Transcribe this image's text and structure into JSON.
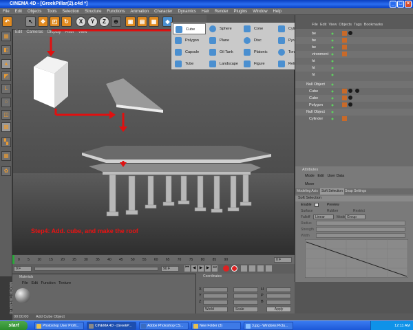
{
  "window": {
    "title": "CINEMA 4D - [GreekPillar(2).c4d *]"
  },
  "menu": [
    "File",
    "Edit",
    "Objects",
    "Tools",
    "Selection",
    "Structure",
    "Functions",
    "Animation",
    "Character",
    "Dynamics",
    "Hair",
    "Render",
    "Plugins",
    "Window",
    "Help"
  ],
  "toolbar": {
    "tools": [
      "undo",
      "redo",
      "move",
      "scale",
      "rotate",
      "x-axis",
      "y-axis",
      "z-axis",
      "world-coords",
      "render-view",
      "render-picture",
      "render-settings",
      "cube"
    ]
  },
  "viewport": {
    "menu": [
      "Edit",
      "Cameras",
      "Display",
      "Filter",
      "View"
    ],
    "step_text": "Step4: Add. cube, and make the roof"
  },
  "primitives_menu": {
    "items": [
      {
        "label": "Cube",
        "selected": true
      },
      {
        "label": "Sphere"
      },
      {
        "label": "Cone"
      },
      {
        "label": "Cylinder"
      },
      {
        "label": "Polygon"
      },
      {
        "label": "Plane"
      },
      {
        "label": "Disc"
      },
      {
        "label": "Pyramid"
      },
      {
        "label": "Capsule"
      },
      {
        "label": "Oil Tank"
      },
      {
        "label": "Platonic"
      },
      {
        "label": "Torus"
      },
      {
        "label": "Tube"
      },
      {
        "label": "Landscape"
      },
      {
        "label": "Figure"
      },
      {
        "label": "Relief"
      }
    ]
  },
  "object_manager": {
    "menu": [
      "File",
      "Edit",
      "View",
      "Objects",
      "Tags",
      "Bookmarks"
    ],
    "rows": [
      "be",
      "be",
      "be",
      "vironment",
      "ht",
      "ht",
      "ht",
      "Null Object",
      "Cube",
      "Cube",
      "Polygon",
      "Null Object",
      "Cylinder"
    ]
  },
  "attributes": {
    "title": "Attributes",
    "menu": [
      "Mode",
      "Edit",
      "User Data"
    ],
    "object": "Move",
    "tabs": [
      "Modeling Axis",
      "Soft Selection",
      "Snap Settings"
    ],
    "section": "Soft Selection",
    "fields": {
      "enable": "Enable",
      "preview": "Preview",
      "surface": "Surface",
      "rubber": "Rubber",
      "restrict": "Restrict",
      "falloff": "Falloff",
      "falloff_value": "Linear",
      "mode": "Mode",
      "mode_value": "Group",
      "radius": "Radius",
      "strength": "Strength",
      "width": "Width"
    }
  },
  "timeline": {
    "ticks": [
      "0",
      "5",
      "10",
      "15",
      "20",
      "25",
      "30",
      "35",
      "40",
      "45",
      "50",
      "55",
      "60",
      "65",
      "70",
      "75",
      "80",
      "85",
      "90"
    ],
    "frame": "0 F"
  },
  "playback": {
    "current_frame": "0 F",
    "end_frame": "90 F"
  },
  "materials": {
    "title": "Materials",
    "menu": [
      "File",
      "Edit",
      "Function",
      "Texture"
    ]
  },
  "coordinates": {
    "title": "Coordinates",
    "axes": [
      "X",
      "Y",
      "Z"
    ],
    "rot_axes": [
      "H",
      "P",
      "B"
    ],
    "mode1": "World",
    "mode2": "Scale",
    "apply": "Apply"
  },
  "status": {
    "text": "Add Cube Object",
    "time": "00:00:00"
  },
  "maxon_label": "MAXON CINEMA 4D",
  "taskbar": {
    "start": "start",
    "tasks": [
      "Photoshop User Profil...",
      "CINEMA 4D - [GreekP...",
      "Adobe Photoshop CS...",
      "New Folder (3)",
      "3.jpg - Windows Pictu..."
    ],
    "clock": "12:11 AM"
  },
  "colors": {
    "arrow": "#e01010",
    "accent": "#e08a20",
    "taskbar": "#245edc"
  }
}
